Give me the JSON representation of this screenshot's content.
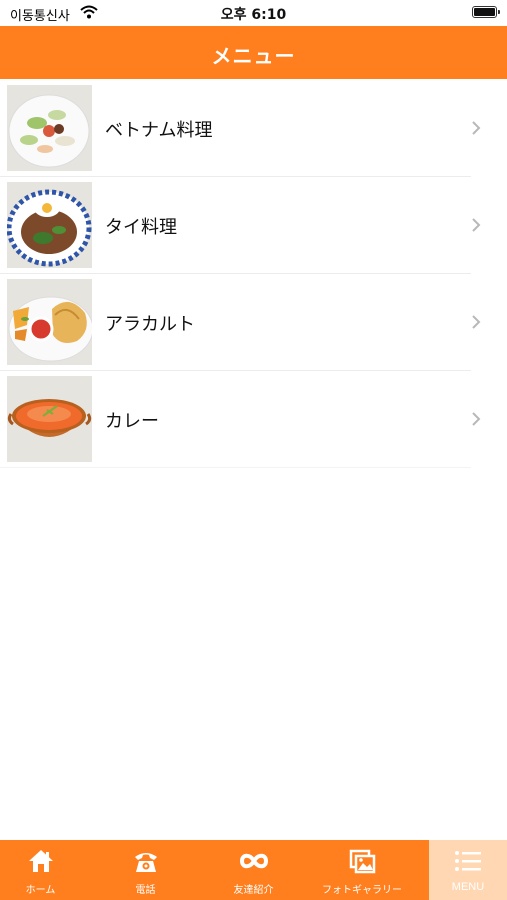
{
  "status_bar": {
    "carrier": "이동통신사",
    "time": "오후 6:10"
  },
  "header": {
    "title": "メニュー"
  },
  "menu": {
    "items": [
      {
        "label": "ベトナム料理",
        "icon": "vietnamese-dish-photo"
      },
      {
        "label": "タイ料理",
        "icon": "thai-dish-photo"
      },
      {
        "label": "アラカルト",
        "icon": "a-la-carte-photo"
      },
      {
        "label": "カレー",
        "icon": "curry-photo"
      }
    ]
  },
  "tab_bar": {
    "tabs": [
      {
        "label": "ホーム",
        "icon": "home-icon"
      },
      {
        "label": "電話",
        "icon": "phone-icon"
      },
      {
        "label": "友達紹介",
        "icon": "infinity-icon"
      },
      {
        "label": "フォトギャラリー",
        "icon": "photo-gallery-icon"
      },
      {
        "label": "MENU",
        "icon": "menu-icon"
      }
    ],
    "active_tab": "MENU"
  },
  "colors": {
    "accent": "#ff7f1e",
    "active_tab_bg": "#ffd7b2",
    "text": "#111111",
    "chevron": "#b8b8b8"
  }
}
